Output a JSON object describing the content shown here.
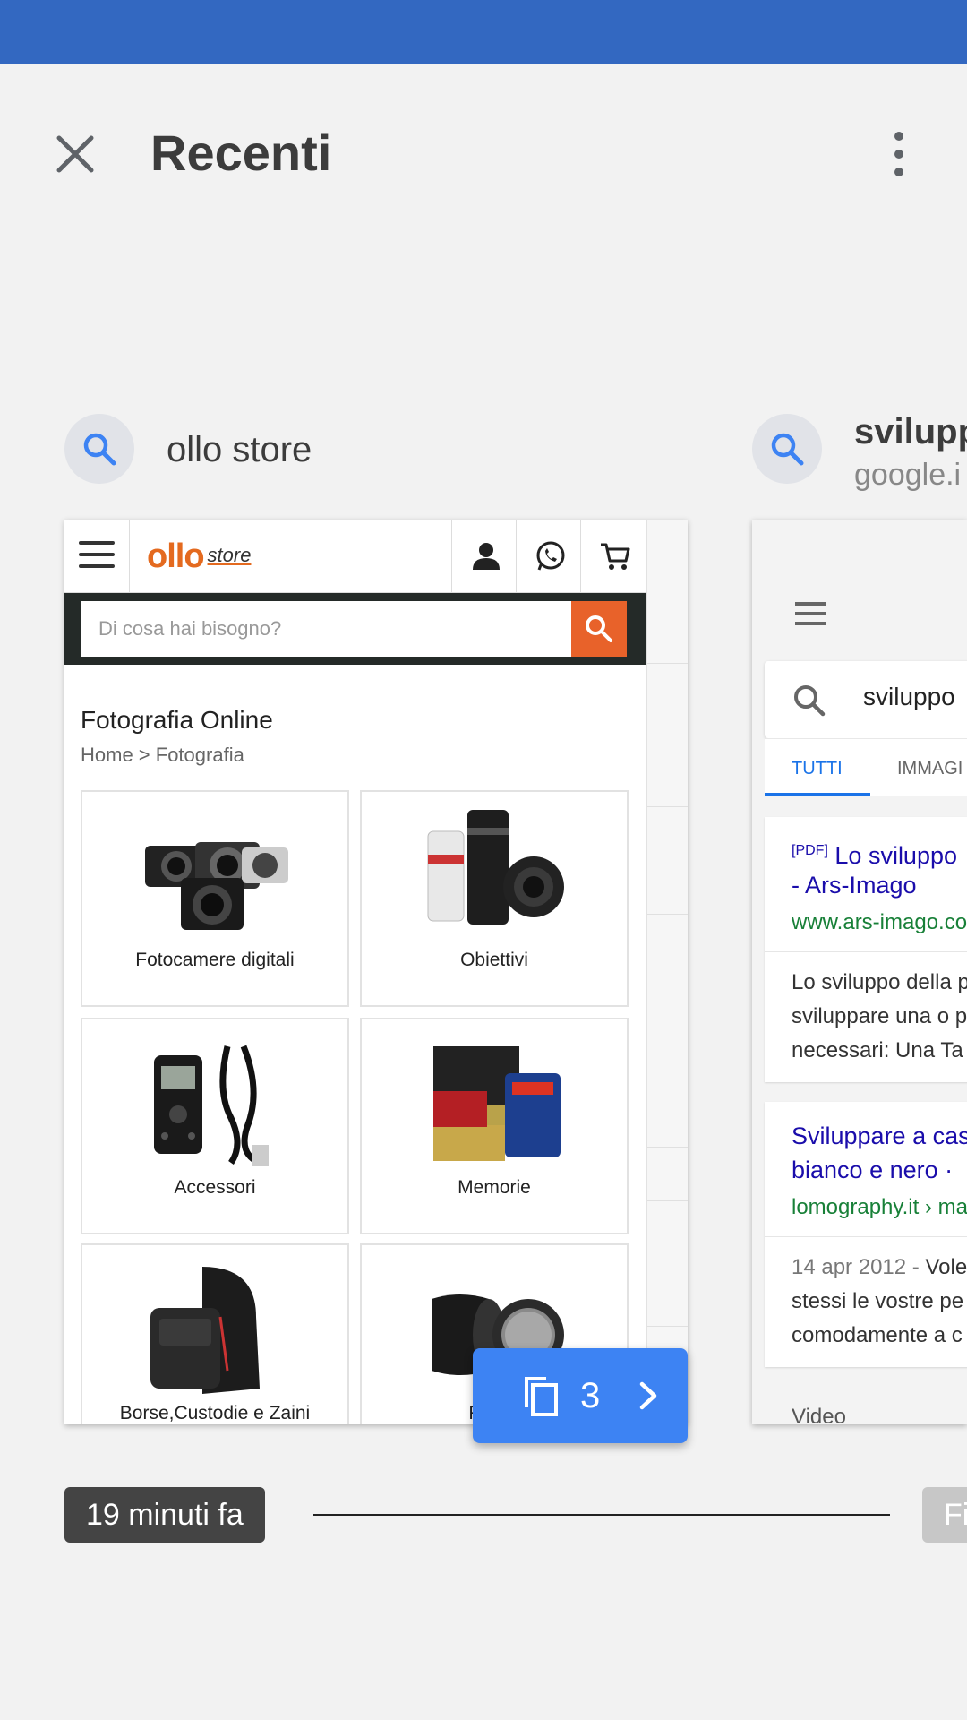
{
  "header": {
    "title": "Recenti",
    "close_icon": "close-icon",
    "more_icon": "more-vert-icon"
  },
  "entries": [
    {
      "query": "ollo store",
      "site": {
        "logo_text": "ollo",
        "logo_suffix": "store",
        "search_placeholder": "Di cosa hai bisogno?",
        "category_title": "Fotografia Online",
        "breadcrumb": "Home > Fotografia",
        "tiles": [
          {
            "label": "Fotocamere digitali",
            "icon": "camera-icon"
          },
          {
            "label": "Obiettivi",
            "icon": "lens-icon"
          },
          {
            "label": "Accessori",
            "icon": "remote-icon"
          },
          {
            "label": "Memorie",
            "icon": "memory-card-icon"
          },
          {
            "label": "Borse,Custodie e Zaini",
            "icon": "bag-icon"
          },
          {
            "label": "Filtri e",
            "icon": "filter-icon"
          }
        ]
      },
      "tab_count": "3",
      "time": "19 minuti fa"
    },
    {
      "query": "svilupp",
      "domain": "google.i",
      "page": {
        "search_text": "sviluppo",
        "tabs": [
          "TUTTI",
          "IMMAGI"
        ],
        "results": [
          {
            "tag": "[PDF]",
            "title_line1": "Lo sviluppo",
            "title_line2": "- Ars-Imago",
            "url": "www.ars-imago.co",
            "snippet": [
              "Lo sviluppo della p",
              "sviluppare una o p",
              "necessari: Una Ta"
            ]
          },
          {
            "title_line1": "Sviluppare a cas",
            "title_line2": "bianco e nero ·",
            "url": "lomography.it › ma",
            "date": "14 apr 2012 -",
            "snippet": [
              "Vole",
              "stessi le vostre pe",
              "comodamente a c"
            ]
          }
        ],
        "section": "Video"
      },
      "time": "Fi"
    }
  ],
  "colors": {
    "status_bar": "#3368c1",
    "accent": "#3d83f3",
    "ollo_orange": "#e46a1f"
  }
}
